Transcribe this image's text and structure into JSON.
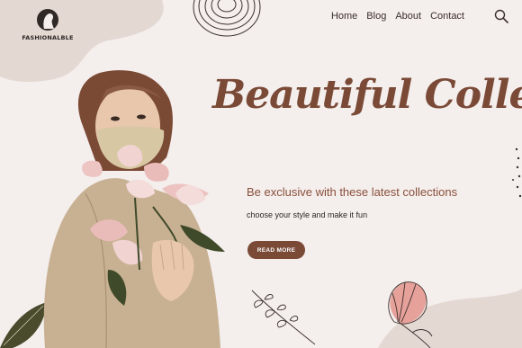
{
  "brand": {
    "name": "FASHIONALBLE",
    "logo_icon": "woman-silhouette-icon"
  },
  "nav": {
    "items": [
      "Home",
      "Blog",
      "About",
      "Contact"
    ],
    "search_icon": "search-icon"
  },
  "hero": {
    "title": "Beautiful Collection",
    "headline": "Be exclusive with these latest collections",
    "subline": "choose your style and make it fun",
    "cta_label": "READ MORE"
  },
  "colors": {
    "background": "#f4eeec",
    "accent": "#7a4a37",
    "blob": "#e4d8d3",
    "flower": "#e6a19a"
  }
}
